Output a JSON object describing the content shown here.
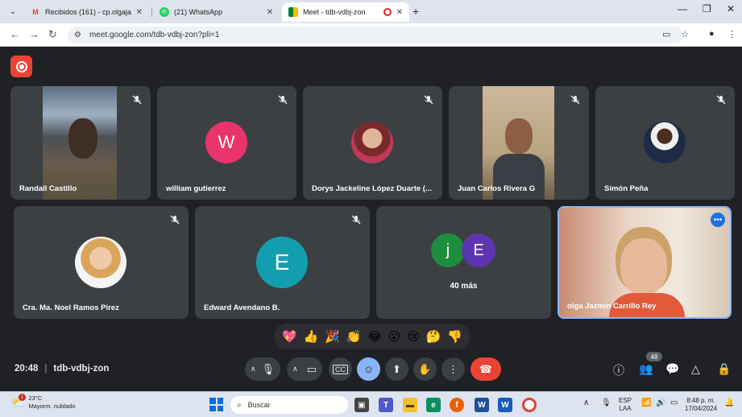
{
  "browser": {
    "tabs": [
      {
        "title": "Recibidos (161) - cp.olgajazmin",
        "favicon": "gmail-icon",
        "active": false
      },
      {
        "title": "(21) WhatsApp",
        "favicon": "whatsapp-icon",
        "active": false
      },
      {
        "title": "Meet - tdb-vdbj-zon",
        "favicon": "meet-icon",
        "active": true
      }
    ],
    "url": "meet.google.com/tdb-vdbj-zon?pli=1"
  },
  "meet": {
    "meeting_code": "tdb-vdbj-zon",
    "time": "20:48",
    "participants_row1": [
      {
        "name": "Randall Castillo",
        "type": "video"
      },
      {
        "name": "william gutierrez",
        "type": "letter",
        "letter": "W",
        "color": "#e8336d"
      },
      {
        "name": "Dorys Jackeline López Duarte (...",
        "type": "photo"
      },
      {
        "name": "Juan Carlos Rivera G",
        "type": "video"
      },
      {
        "name": "Simón Peña",
        "type": "photo"
      }
    ],
    "participants_row2": [
      {
        "name": "Cra. Ma. Noel Ramos Pirez",
        "type": "photo"
      },
      {
        "name": "Edward Avendano B.",
        "type": "letter",
        "letter": "E",
        "color": "#129eaf"
      },
      {
        "name": "olga Jazmin Carrillo Rey",
        "type": "video"
      }
    ],
    "overflow": {
      "letters": [
        "j",
        "E"
      ],
      "colors": [
        "#1e8e3e",
        "#5e35b1"
      ],
      "label": "40 más"
    },
    "reactions": [
      "💖",
      "👍",
      "🎉",
      "👏",
      "😂",
      "😮",
      "😢",
      "🤔",
      "👎"
    ],
    "participant_count": "48"
  },
  "taskbar": {
    "weather_temp": "23°C",
    "weather_desc": "Mayorm. nublado",
    "weather_badge": "1",
    "search_placeholder": "Buscar",
    "lang_top": "ESP",
    "lang_bottom": "LAA",
    "clock_time": "8:48 p. m.",
    "clock_date": "17/04/2024"
  }
}
